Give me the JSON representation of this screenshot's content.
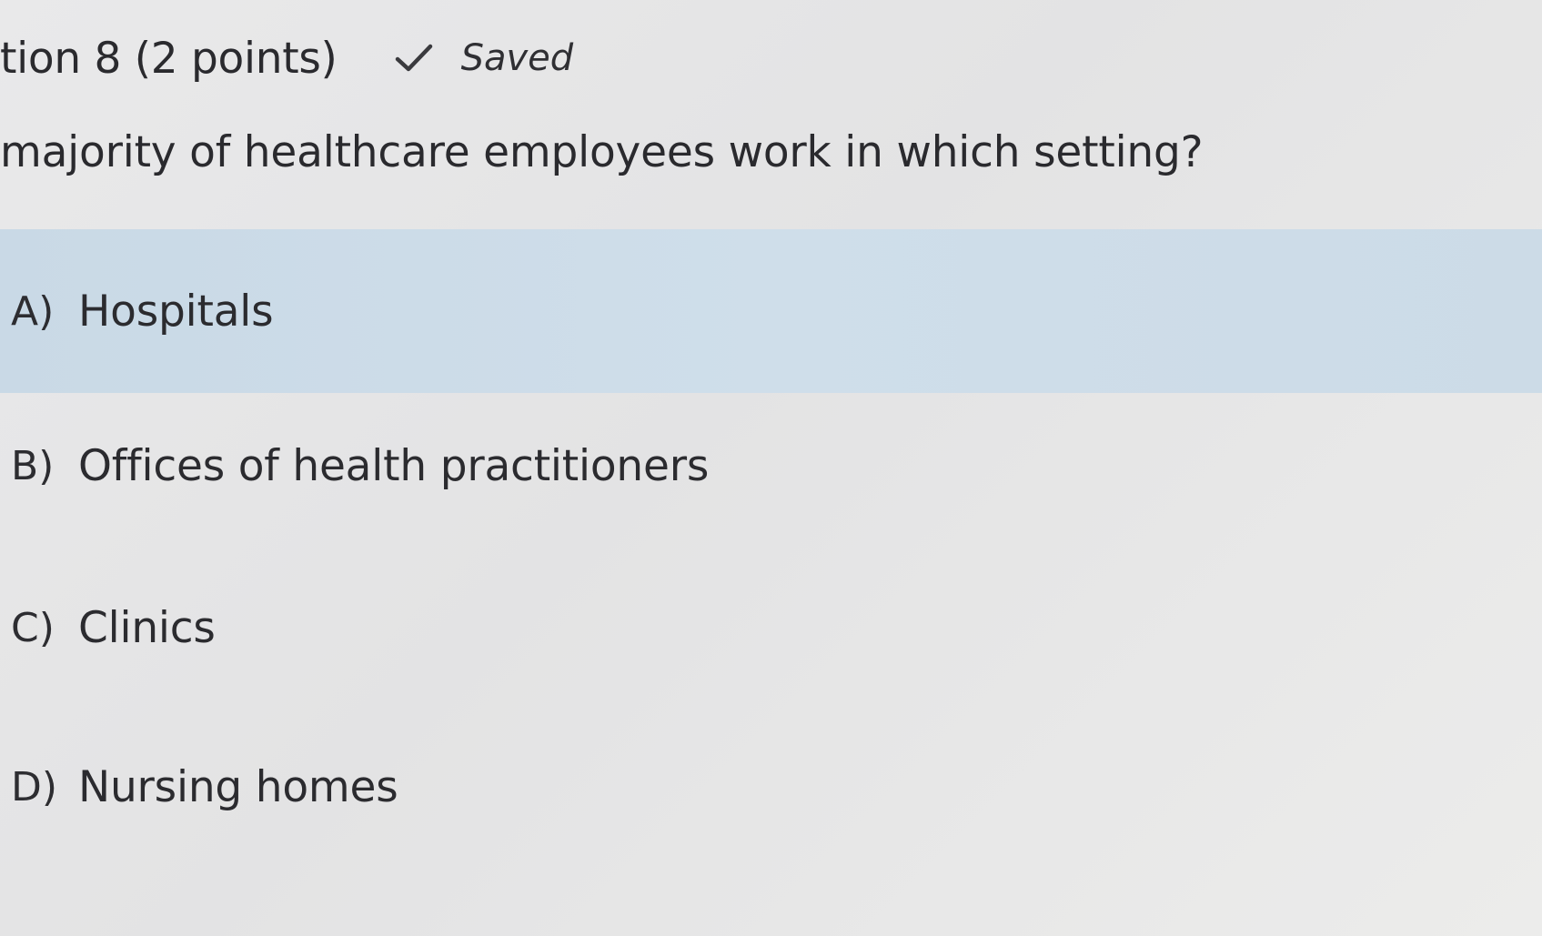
{
  "question": {
    "header": "tion 8 (2 points)",
    "saved_label": "Saved",
    "saved_icon": "checkmark-icon",
    "text": "majority of healthcare employees work in which setting?"
  },
  "options": [
    {
      "letter": "A)",
      "text": "Hospitals",
      "selected": true
    },
    {
      "letter": "B)",
      "text": "Offices of health practitioners",
      "selected": false
    },
    {
      "letter": "C)",
      "text": "Clinics",
      "selected": false
    },
    {
      "letter": "D)",
      "text": "Nursing homes",
      "selected": false
    }
  ],
  "colors": {
    "background": "#e6e6e7",
    "selected_option": "#cddce8",
    "text": "#2b2b2f"
  }
}
